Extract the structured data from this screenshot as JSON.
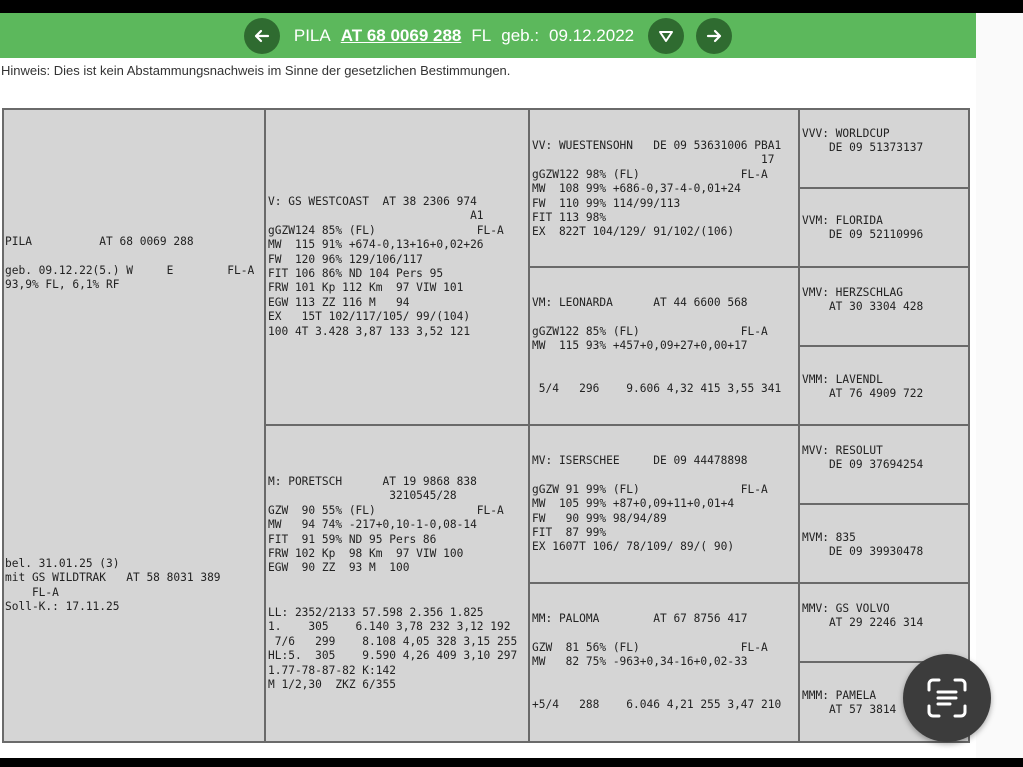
{
  "header": {
    "name": "PILA",
    "id": "AT 68 0069 288",
    "breed": "FL",
    "birth_label": "geb.:",
    "birth_date": "09.12.2022",
    "back_icon": "arrow-left-icon",
    "forward_icon": "arrow-right-icon",
    "dropdown_icon": "triangle-down-icon"
  },
  "notice": "Hinweis: Dies ist kein Abstammungsnachweis im Sinne der gesetzlichen Bestimmungen.",
  "animal": {
    "top": "PILA          AT 68 0069 288\n\ngeb. 09.12.22(5.) W     E        FL-A\n93,9% FL, 6,1% RF",
    "bottom": "bel. 31.01.25 (3)\nmit GS WILDTRAK   AT 58 8031 389\n    FL-A\nSoll-K.: 17.11.25"
  },
  "sire": {
    "text": "V: GS WESTCOAST  AT 38 2306 974\n                              A1\ngGZW124 85% (FL)               FL-A\nMW  115 91% +674-0,13+16+0,02+26\nFW  120 96% 129/106/117\nFIT 106 86% ND 104 Pers 95\nFRW 101 Kp 112 Km  97 VIW 101\nEGW 113 ZZ 116 M   94\nEX   15T 102/117/105/ 99/(104)\n100 4T 3.428 3,87 133 3,52 121"
  },
  "dam": {
    "text": "M: PORETSCH      AT 19 9868 838\n                  3210545/28\nGZW  90 55% (FL)               FL-A\nMW   94 74% -217+0,10-1-0,08-14\nFIT  91 59% ND 95 Pers 86\nFRW 102 Kp  98 Km  97 VIW 100\nEGW  90 ZZ  93 M  100",
    "lactation": "LL: 2352/2133 57.598 2.356 1.825\n1.    305    6.140 3,78 232 3,12 192\n 7/6   299    8.108 4,05 328 3,15 255\nHL:5.  305    9.590 4,26 409 3,10 297\n1.77-78-87-82 K:142\nM 1/2,30  ZKZ 6/355"
  },
  "grandparents": [
    {
      "text": "VV: WUESTENSOHN   DE 09 53631006 PBA1\n                                  17\ngGZW122 98% (FL)               FL-A\nMW  108 99% +686-0,37-4-0,01+24\nFW  110 99% 114/99/113\nFIT 113 98%\nEX  822T 104/129/ 91/102/(106)"
    },
    {
      "text": "VM: LEONARDA      AT 44 6600 568\n\ngGZW122 85% (FL)               FL-A\nMW  115 93% +457+0,09+27+0,00+17\n\n\n 5/4   296    9.606 4,32 415 3,55 341"
    },
    {
      "text": "MV: ISERSCHEE     DE 09 44478898\n\ngGZW 91 99% (FL)               FL-A\nMW  105 99% +87+0,09+11+0,01+4\nFW   90 99% 98/94/89\nFIT  87 99%\nEX 1607T 106/ 78/109/ 89/( 90)"
    },
    {
      "text": "MM: PALOMA        AT 67 8756 417\n\nGZW  81 56% (FL)               FL-A\nMW   82 75% -963+0,34-16+0,02-33\n\n\n+5/4   288    6.046 4,21 255 3,47 210"
    }
  ],
  "great_grandparents": [
    {
      "text": "VVV: WORLDCUP\n    DE 09 51373137"
    },
    {
      "text": "VVM: FLORIDA\n    DE 09 52110996"
    },
    {
      "text": "VMV: HERZSCHLAG\n    AT 30 3304 428"
    },
    {
      "text": "VMM: LAVENDL\n    AT 76 4909 722"
    },
    {
      "text": "MVV: RESOLUT\n    DE 09 37694254"
    },
    {
      "text": "MVM: 835\n    DE 09 39930478"
    },
    {
      "text": "MMV: GS VOLVO\n    AT 29 2246 314"
    },
    {
      "text": "MMM: PAMELA\n    AT 57 3814"
    }
  ],
  "fab_icon": "scan-text-icon"
}
